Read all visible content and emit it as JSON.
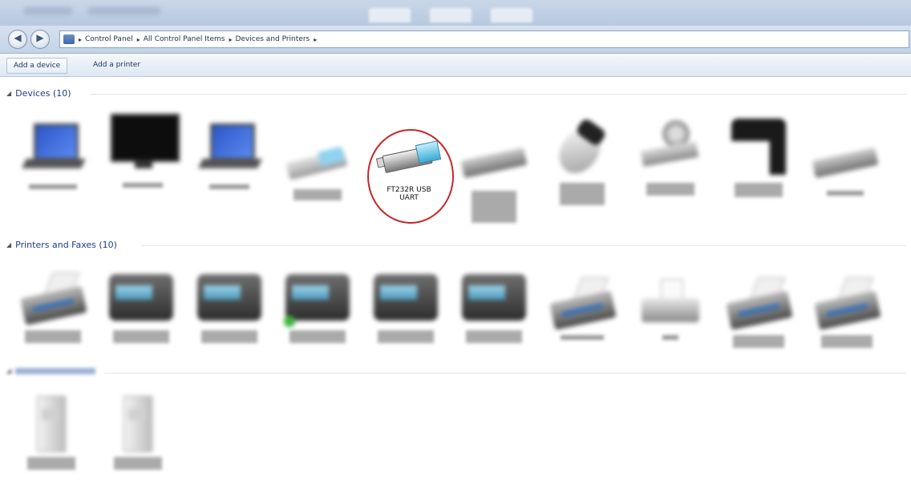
{
  "window": {
    "breadcrumb": [
      "Control Panel",
      "All Control Panel Items",
      "Devices and Printers"
    ],
    "separator": "▸"
  },
  "toolbar": {
    "add_device": "Add a device",
    "add_printer": "Add a printer"
  },
  "groups": {
    "devices": {
      "label": "Devices (10)",
      "arrow": "◢"
    },
    "printers": {
      "label": "Printers and Faxes (10)",
      "arrow": "◢"
    }
  },
  "devices": {
    "ft232r": {
      "label_line1": "FT232R USB",
      "label_line2": "UART"
    }
  },
  "icons": {
    "back": "back-arrow-icon",
    "forward": "forward-arrow-icon",
    "usb": "usb-serial-adapter-icon"
  },
  "colors": {
    "highlight_circle": "#c8262a",
    "group_header": "#1e3b8b",
    "titlebar": "#c9d7e8"
  }
}
